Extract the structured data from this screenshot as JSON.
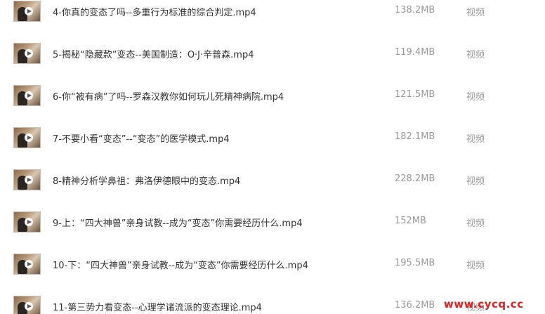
{
  "files": [
    {
      "name": "4-你真的变态了吗--多重行为标准的综合判定.mp4",
      "size": "138.2MB",
      "type": "视频"
    },
    {
      "name": "5-揭秘“隐藏款”变态--美国制造：O·J·辛普森.mp4",
      "size": "119.4MB",
      "type": "视频"
    },
    {
      "name": "6-你“被有病”了吗--罗森汉教你如何玩儿死精神病院.mp4",
      "size": "121.5MB",
      "type": "视频"
    },
    {
      "name": "7-不要小看“变态”--“变态”的医学模式.mp4",
      "size": "182.1MB",
      "type": "视频"
    },
    {
      "name": "8-精神分析学鼻祖：弗洛伊德眼中的变态.mp4",
      "size": "228.2MB",
      "type": "视频"
    },
    {
      "name": "9-上：“四大神兽”亲身试教--成为“变态”你需要经历什么.mp4",
      "size": "152MB",
      "type": "视频"
    },
    {
      "name": "10-下：“四大神兽”亲身试教--成为“变态”你需要经历什么.mp4",
      "size": "195.5MB",
      "type": "视频"
    },
    {
      "name": "11-第三势力看变态--心理学诸流派的变态理论.mp4",
      "size": "136.2MB",
      "type": "视频"
    }
  ],
  "watermark": "www.cycq.cc"
}
